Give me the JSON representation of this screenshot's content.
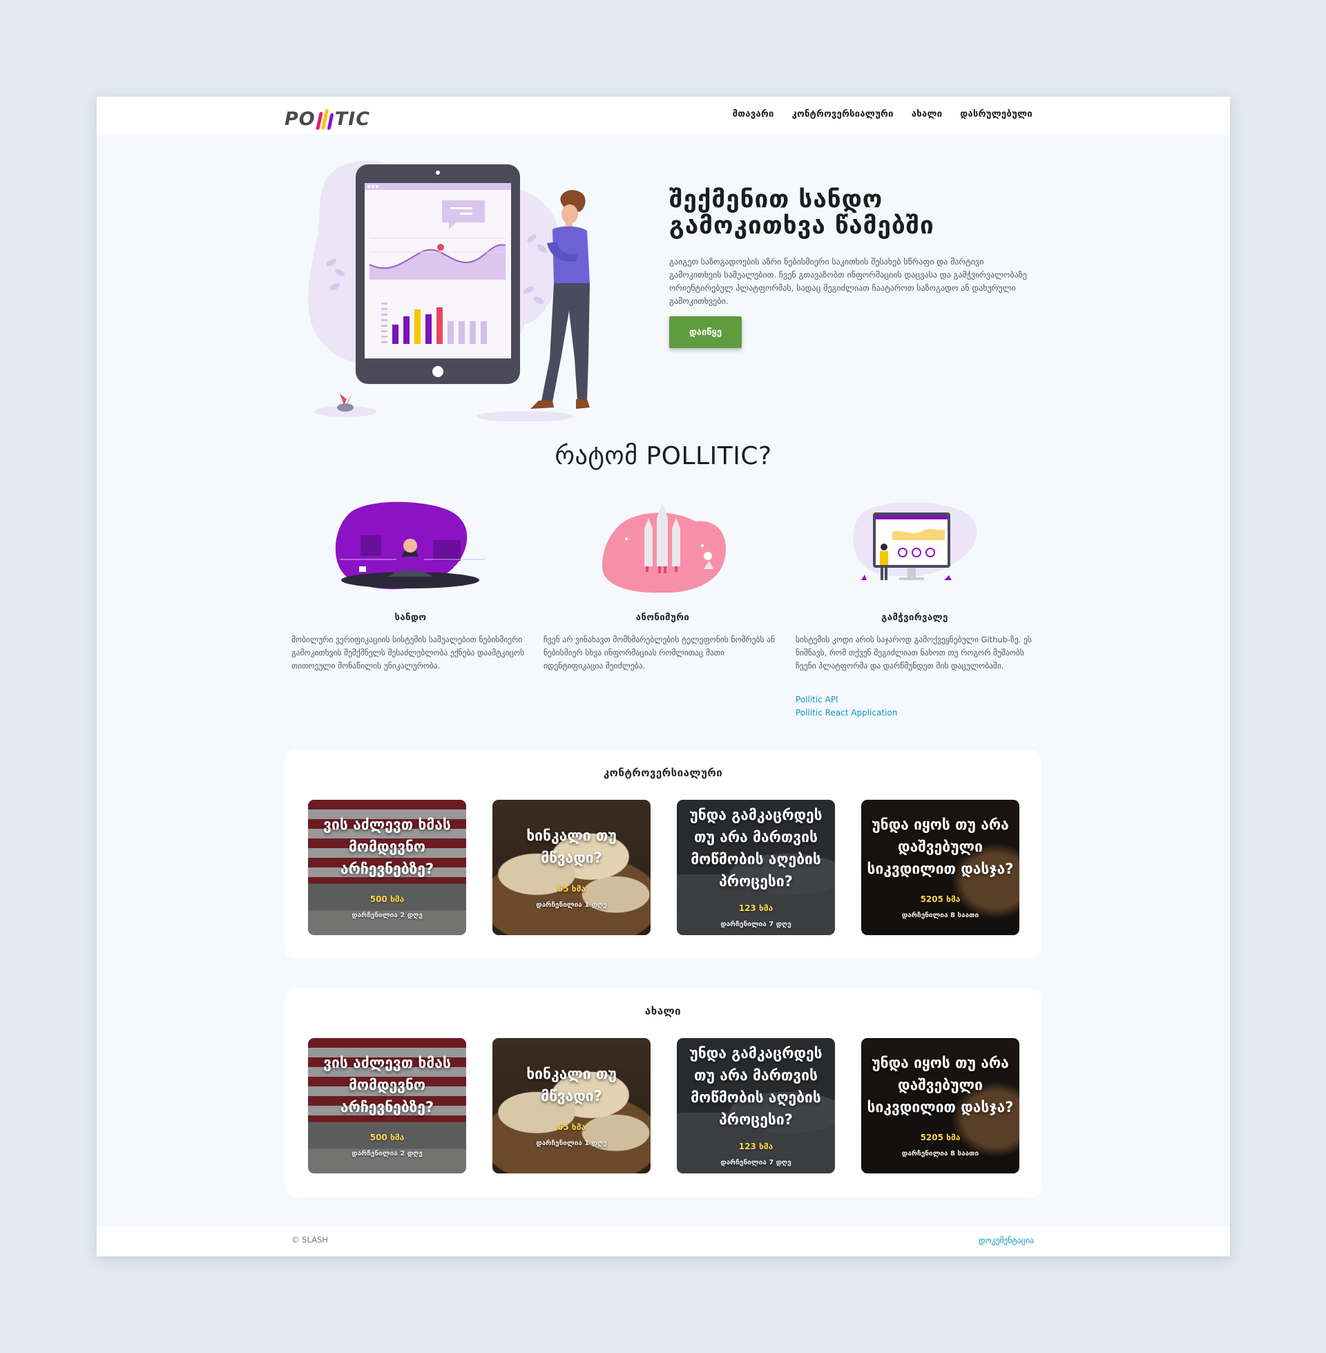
{
  "logo": {
    "text_left": "PO",
    "text_right": "TIC",
    "bar_colors": [
      "#e11d74",
      "#f7c600",
      "#8c13c4"
    ]
  },
  "nav": {
    "links": [
      "მთავარი",
      "კონტროვერსიალური",
      "ახალი",
      "დასრულებული"
    ]
  },
  "hero": {
    "title": "შექმენით სანდო გამოკითხვა წამებში",
    "text": "გაიგეთ საზოგადოების აზრი ნებისმიერი საკითხის შესახებ სწრაფი და მარტივი გამოკითხვის საშუალებით. ჩვენ გთავაზობთ ინფორმაციის დაცვასა და გამჭვირვალობაზე ორიენტირებულ პლატფორმას, სადაც შეგიძლიათ ჩაატაროთ საზოგადო ან დახურული გამოკითხვები.",
    "button_label": "დაიწყე"
  },
  "why": {
    "title": "რატომ POLLITIC?",
    "features": [
      {
        "title": "სანდო",
        "text": "მობილური ვერიფიკაციის სისტემის საშუალებით ნებისმიერი გამოკითხვის შემქმნელს შესაძლებლობა ექნება დაამტკიცოს თითოეული მონაწილის უნიკალურობა."
      },
      {
        "title": "ანონიმური",
        "text": "ჩვენ არ ვინახავთ მომხმარებლების ტელეფონის ნომრებს ან ნებისმიერ სხვა ინფორმაციას რომლითაც მათი იდენტიფიკაცია შეიძლება."
      },
      {
        "title": "გამჭვირვალე",
        "text": "სისტემის კოდი არის საჯაროდ გამოქვეყნებული Github-ზე. ეს ნიშნავს, რომ თქვენ შეგიძლიათ ნახოთ თუ როგორ მუშაობს ჩვენი პლატფორმა და დარწმუნდეთ მის დაცულობაში.",
        "links": [
          "Pollitic API",
          "Pollitic React Application"
        ]
      }
    ]
  },
  "sections": [
    {
      "title": "კონტროვერსიალური",
      "cards": [
        {
          "title": "ვის აძლევთ ხმას მომდევნო არჩევნებზე?",
          "votes": "500 ხმა",
          "meta": "დარჩენილია 2 დღე"
        },
        {
          "title": "ხინკალი თუ მწვადი?",
          "votes": "65 ხმა",
          "meta": "დარჩენილია 1 დღე"
        },
        {
          "title": "უნდა გამკაცრდეს თუ არა მართვის მოწმობის აღების პროცესი?",
          "votes": "123 ხმა",
          "meta": "დარჩენილია 7 დღე"
        },
        {
          "title": "უნდა იყოს თუ არა დაშვებული სიკვდილით დასჯა?",
          "votes": "5205 ხმა",
          "meta": "დარჩენილია 8 საათი"
        }
      ]
    },
    {
      "title": "ახალი",
      "cards": [
        {
          "title": "ვის აძლევთ ხმას მომდევნო არჩევნებზე?",
          "votes": "500 ხმა",
          "meta": "დარჩენილია 2 დღე"
        },
        {
          "title": "ხინკალი თუ მწვადი?",
          "votes": "65 ხმა",
          "meta": "დარჩენილია 1 დღე"
        },
        {
          "title": "უნდა გამკაცრდეს თუ არა მართვის მოწმობის აღების პროცესი?",
          "votes": "123 ხმა",
          "meta": "დარჩენილია 7 დღე"
        },
        {
          "title": "უნდა იყოს თუ არა დაშვებული სიკვდილით დასჯა?",
          "votes": "5205 ხმა",
          "meta": "დარჩენილია 8 საათი"
        }
      ]
    }
  ],
  "footer": {
    "copyright": "© SLASH",
    "doc_link": "დოკუმენტაცია"
  },
  "colors": {
    "accent_green": "#5f9c3e",
    "link_blue": "#1591d0",
    "brand_purple": "#8c13c4",
    "vote_yellow": "#ffd84a"
  }
}
